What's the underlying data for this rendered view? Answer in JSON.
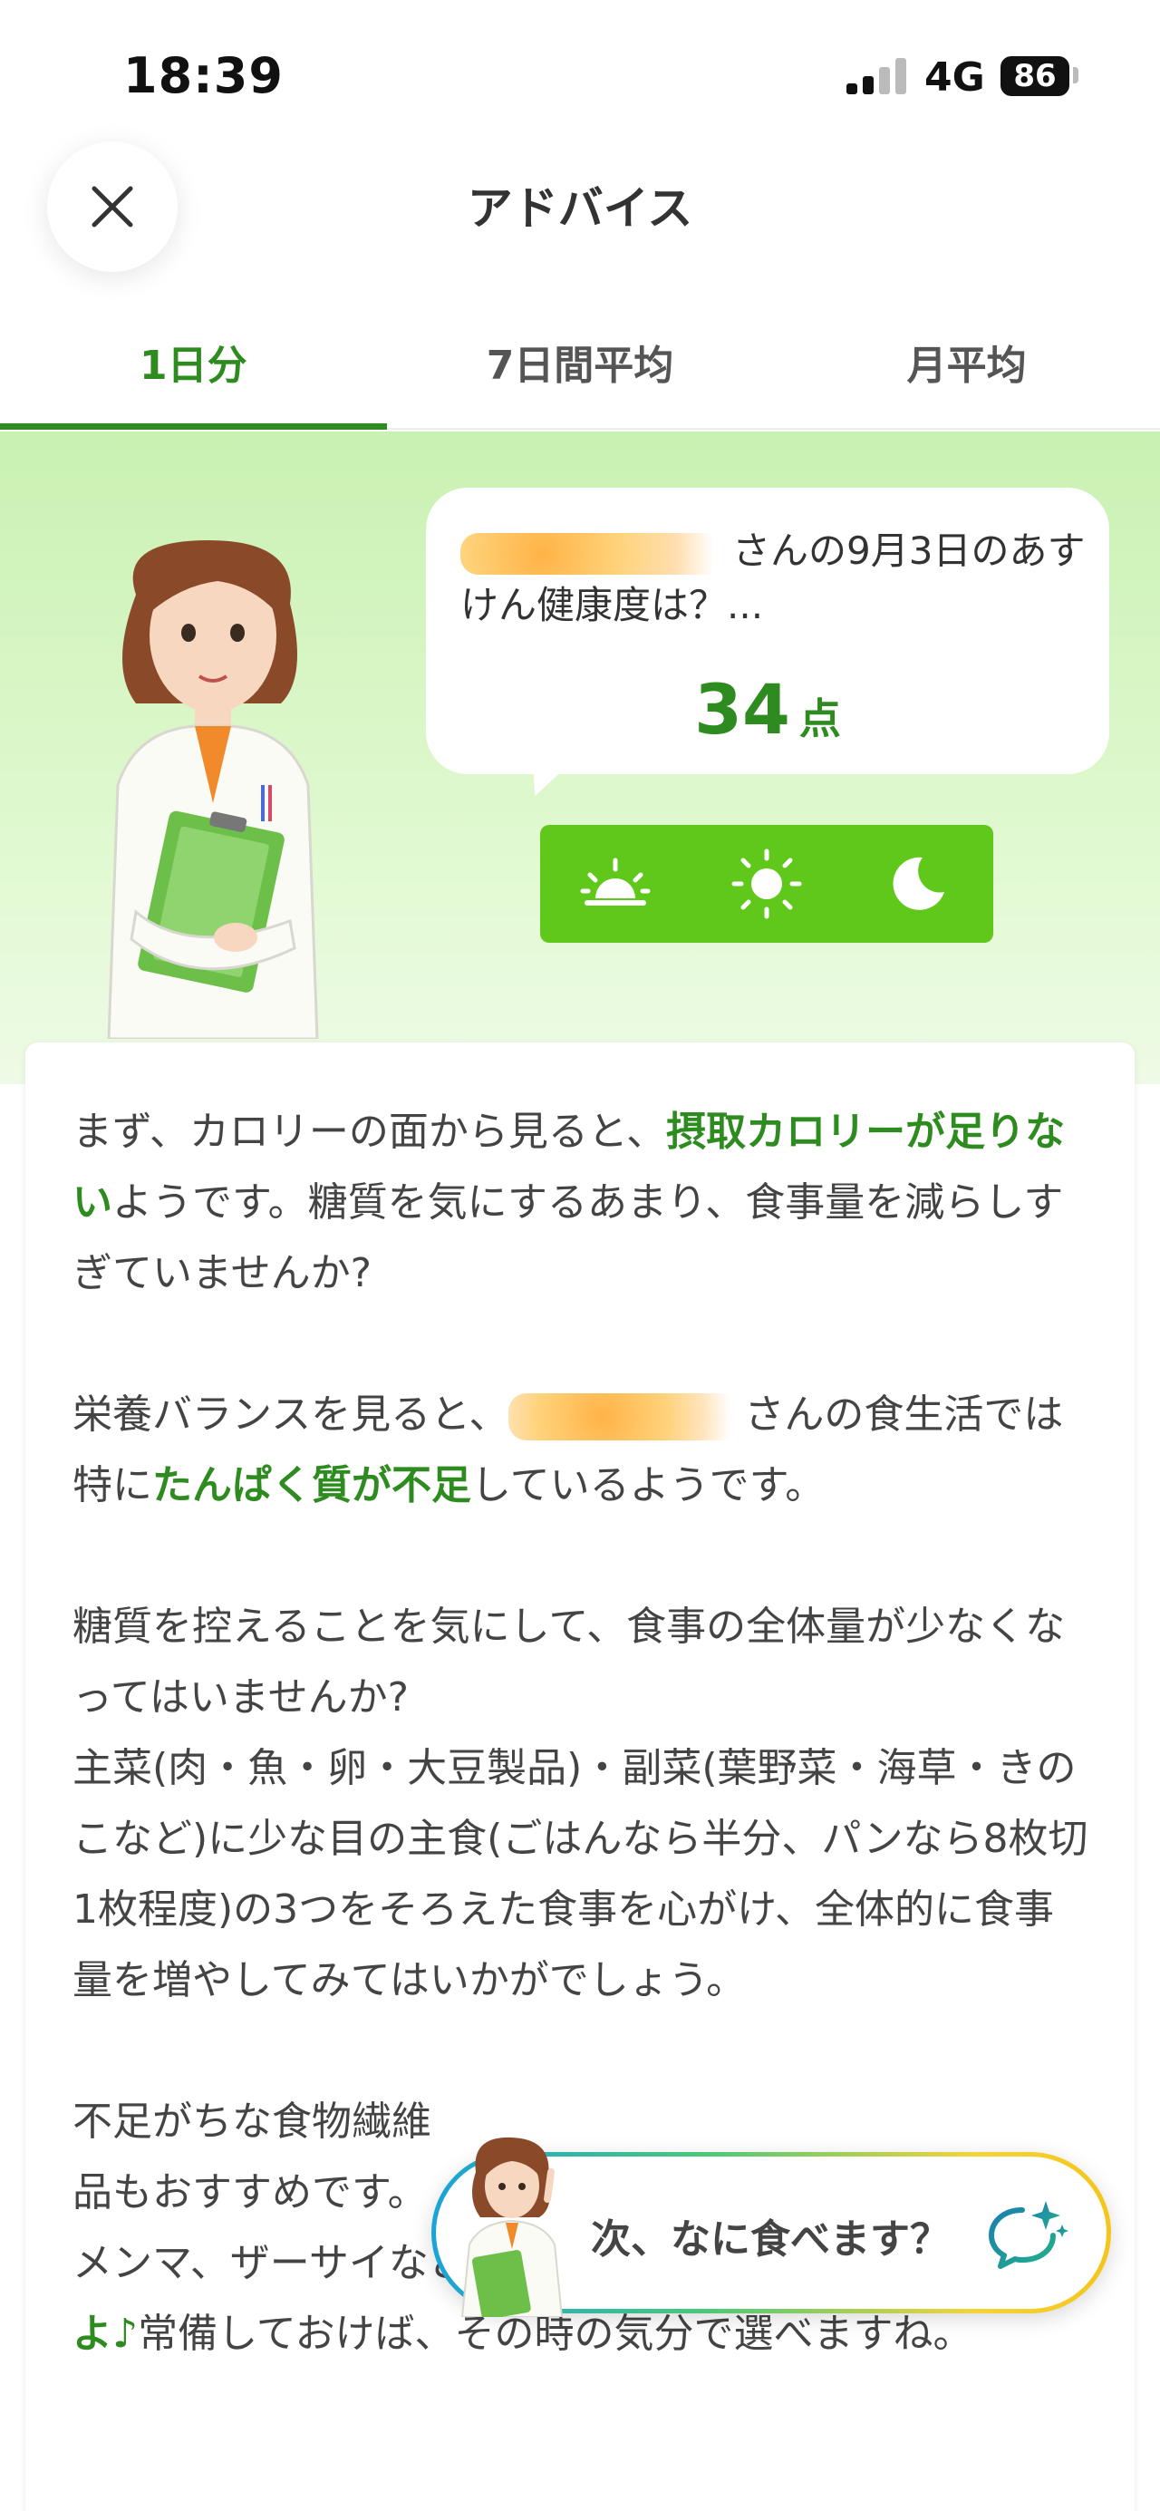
{
  "status": {
    "time": "18:39",
    "network": "4G",
    "battery": "86"
  },
  "header": {
    "title": "アドバイス",
    "close_icon": "close-icon"
  },
  "tabs": [
    {
      "label": "1日分",
      "active": true
    },
    {
      "label": "7日間平均",
      "active": false
    },
    {
      "label": "月平均",
      "active": false
    }
  ],
  "bubble": {
    "text_prefix": "",
    "text_suffix": "さんの9月3日のあすけん健康度は？...",
    "score_value": "34",
    "score_unit": "点"
  },
  "meal_icons": [
    "sunrise-icon",
    "sun-icon",
    "moon-icon"
  ],
  "advice": {
    "p1_a": "まず、カロリーの面から見ると、",
    "p1_hl": "摂取カロリーが足りない",
    "p1_b": "ようです。糖質を気にするあまり、食事量を減らしすぎていませんか?",
    "p2_a": "栄養バランスを見ると、",
    "p2_b": "さんの食生活では特に",
    "p2_hl": "たんぱく質が不足",
    "p2_c": "しているようです。",
    "p3": "糖質を控えることを気にして、食事の全体量が少なくなってはいませんか?",
    "p3_b": "主菜(肉・魚・卵・大豆製品)・副菜(葉野菜・海草・きのこなど)に少な目の主食(ごはんなら半分、パンなら8枚切1枚程度)の3つをそろえた食事を心がけ、全体的に食事量を増やしてみてはいかがでしょう。",
    "p4_a": "不足がちな食物繊維",
    "p4_b": "品もおすすめです。",
    "p4_c": "メンマ、ザーサイなどどれも",
    "p4_hl": "食物繊維が含まれていますよ♪",
    "p4_d": "常備しておけば、その時の気分で選べますね。"
  },
  "ask": {
    "label": "次、なに食べます？"
  }
}
